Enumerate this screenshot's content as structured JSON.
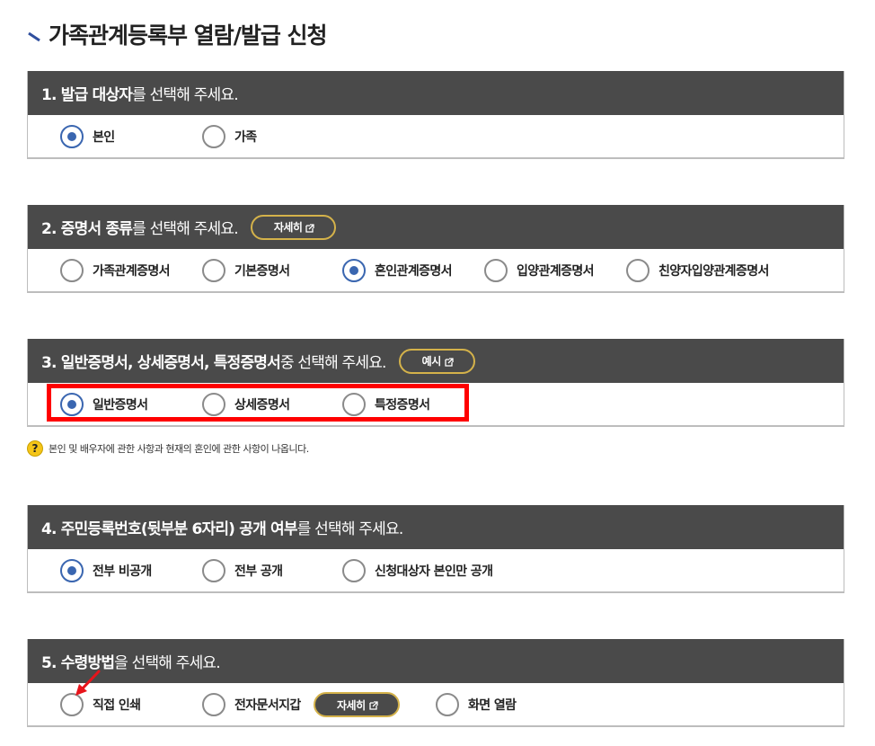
{
  "page": {
    "title": "가족관계등록부 열람/발급 신청"
  },
  "sections": [
    {
      "head_bold": "1. 발급 대상자",
      "head_normal": "를 선택해 주세요.",
      "options": [
        {
          "label": "본인",
          "checked": true
        },
        {
          "label": "가족",
          "checked": false
        }
      ]
    },
    {
      "head_bold": "2. 증명서 종류",
      "head_normal": "를 선택해 주세요.",
      "button": "자세히",
      "options": [
        {
          "label": "가족관계증명서",
          "checked": false
        },
        {
          "label": "기본증명서",
          "checked": false
        },
        {
          "label": "혼인관계증명서",
          "checked": true
        },
        {
          "label": "입양관계증명서",
          "checked": false
        },
        {
          "label": "친양자입양관계증명서",
          "checked": false
        }
      ]
    },
    {
      "head_bold": "3. 일반증명서, 상세증명서, 특정증명서",
      "head_normal": " 중 선택해 주세요.",
      "button": "예시",
      "options": [
        {
          "label": "일반증명서",
          "checked": true
        },
        {
          "label": "상세증명서",
          "checked": false
        },
        {
          "label": "특정증명서",
          "checked": false
        }
      ],
      "note": "본인 및 배우자에 관한 사항과 현재의 혼인에 관한 사항이 나옵니다."
    },
    {
      "head_bold": "4. 주민등록번호(뒷부분 6자리) 공개 여부",
      "head_normal": "를 선택해 주세요.",
      "options": [
        {
          "label": "전부 비공개",
          "checked": true
        },
        {
          "label": "전부 공개",
          "checked": false
        },
        {
          "label": "신청대상자 본인만 공개",
          "checked": false
        }
      ]
    },
    {
      "head_bold": "5. 수령방법",
      "head_normal": "을 선택해 주세요.",
      "options": [
        {
          "label": "직접 인쇄",
          "checked": false
        },
        {
          "label": "전자문서지갑",
          "checked": false
        },
        {
          "label": "화면 열람",
          "checked": false
        }
      ],
      "inline_button": "자세히"
    }
  ],
  "colors": {
    "header_bg": "#4a4a4a",
    "radio_checked": "#3a66b0",
    "button_border": "#d4b24a",
    "highlight": "#ff0000",
    "arrow": "#e8141b"
  },
  "icons": {
    "title_mark": "diagonal-line-icon",
    "external": "external-link-icon",
    "help": "question-icon",
    "annotation": "red-arrow-icon"
  },
  "help_icon_glyph": "?"
}
